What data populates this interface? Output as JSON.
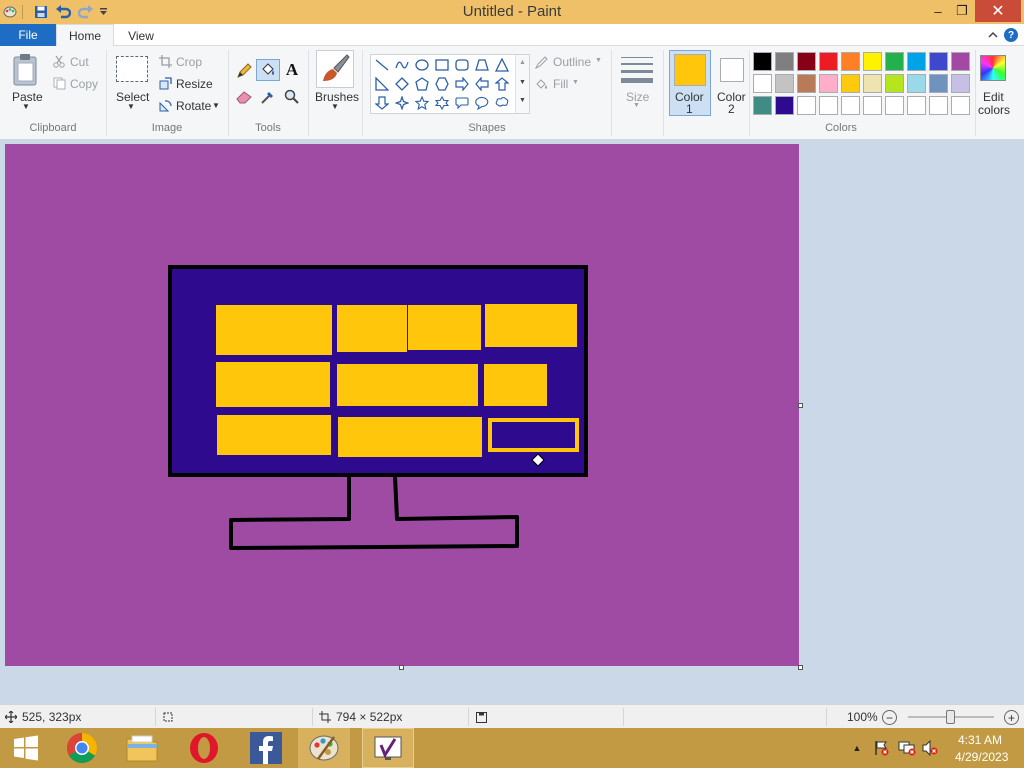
{
  "window": {
    "title": "Untitled - Paint",
    "controls": {
      "minimize": "–",
      "restore": "❐",
      "close": "✕"
    }
  },
  "tabs": {
    "file": "File",
    "home": "Home",
    "view": "View"
  },
  "ribbon": {
    "clipboard": {
      "paste": "Paste",
      "cut": "Cut",
      "copy": "Copy",
      "group": "Clipboard"
    },
    "image": {
      "select": "Select",
      "crop": "Crop",
      "resize": "Resize",
      "rotate": "Rotate",
      "group": "Image"
    },
    "tools": {
      "group": "Tools",
      "text_tool": "A"
    },
    "brushes": {
      "label": "Brushes"
    },
    "shapes": {
      "outline": "Outline",
      "fill": "Fill",
      "group": "Shapes"
    },
    "size": {
      "label": "Size"
    },
    "color1": {
      "line1": "Color",
      "line2": "1",
      "value": "#ffc60b"
    },
    "color2": {
      "line1": "Color",
      "line2": "2",
      "value": "#ffffff"
    },
    "colors": {
      "group": "Colors"
    },
    "edit_colors": {
      "line1": "Edit",
      "line2": "colors"
    },
    "palette_row1": [
      "#000000",
      "#7f7f7f",
      "#880015",
      "#ed1c24",
      "#ff7f27",
      "#fff200",
      "#22b14c",
      "#00a2e8",
      "#3f48cc",
      "#a349a4"
    ],
    "palette_row2": [
      "#ffffff",
      "#c3c3c3",
      "#b97a57",
      "#ffaec9",
      "#ffc90e",
      "#efe4b0",
      "#b5e61d",
      "#99d9ea",
      "#7092be",
      "#c8bfe7"
    ],
    "palette_row3": [
      "#3f8c85",
      "#2e0a8e",
      "#ffffff",
      "#ffffff",
      "#ffffff",
      "#ffffff",
      "#ffffff",
      "#ffffff",
      "#ffffff",
      "#ffffff"
    ]
  },
  "canvas": {
    "background": "#a04ba3",
    "monitor_screen": "#2e0a8e",
    "tile_color": "#ffc60b"
  },
  "status": {
    "cursor_position": "525, 323px",
    "image_size": "794 × 522px",
    "zoom": "100%"
  },
  "taskbar": {
    "time": "4:31 AM",
    "date": "4/29/2023"
  }
}
